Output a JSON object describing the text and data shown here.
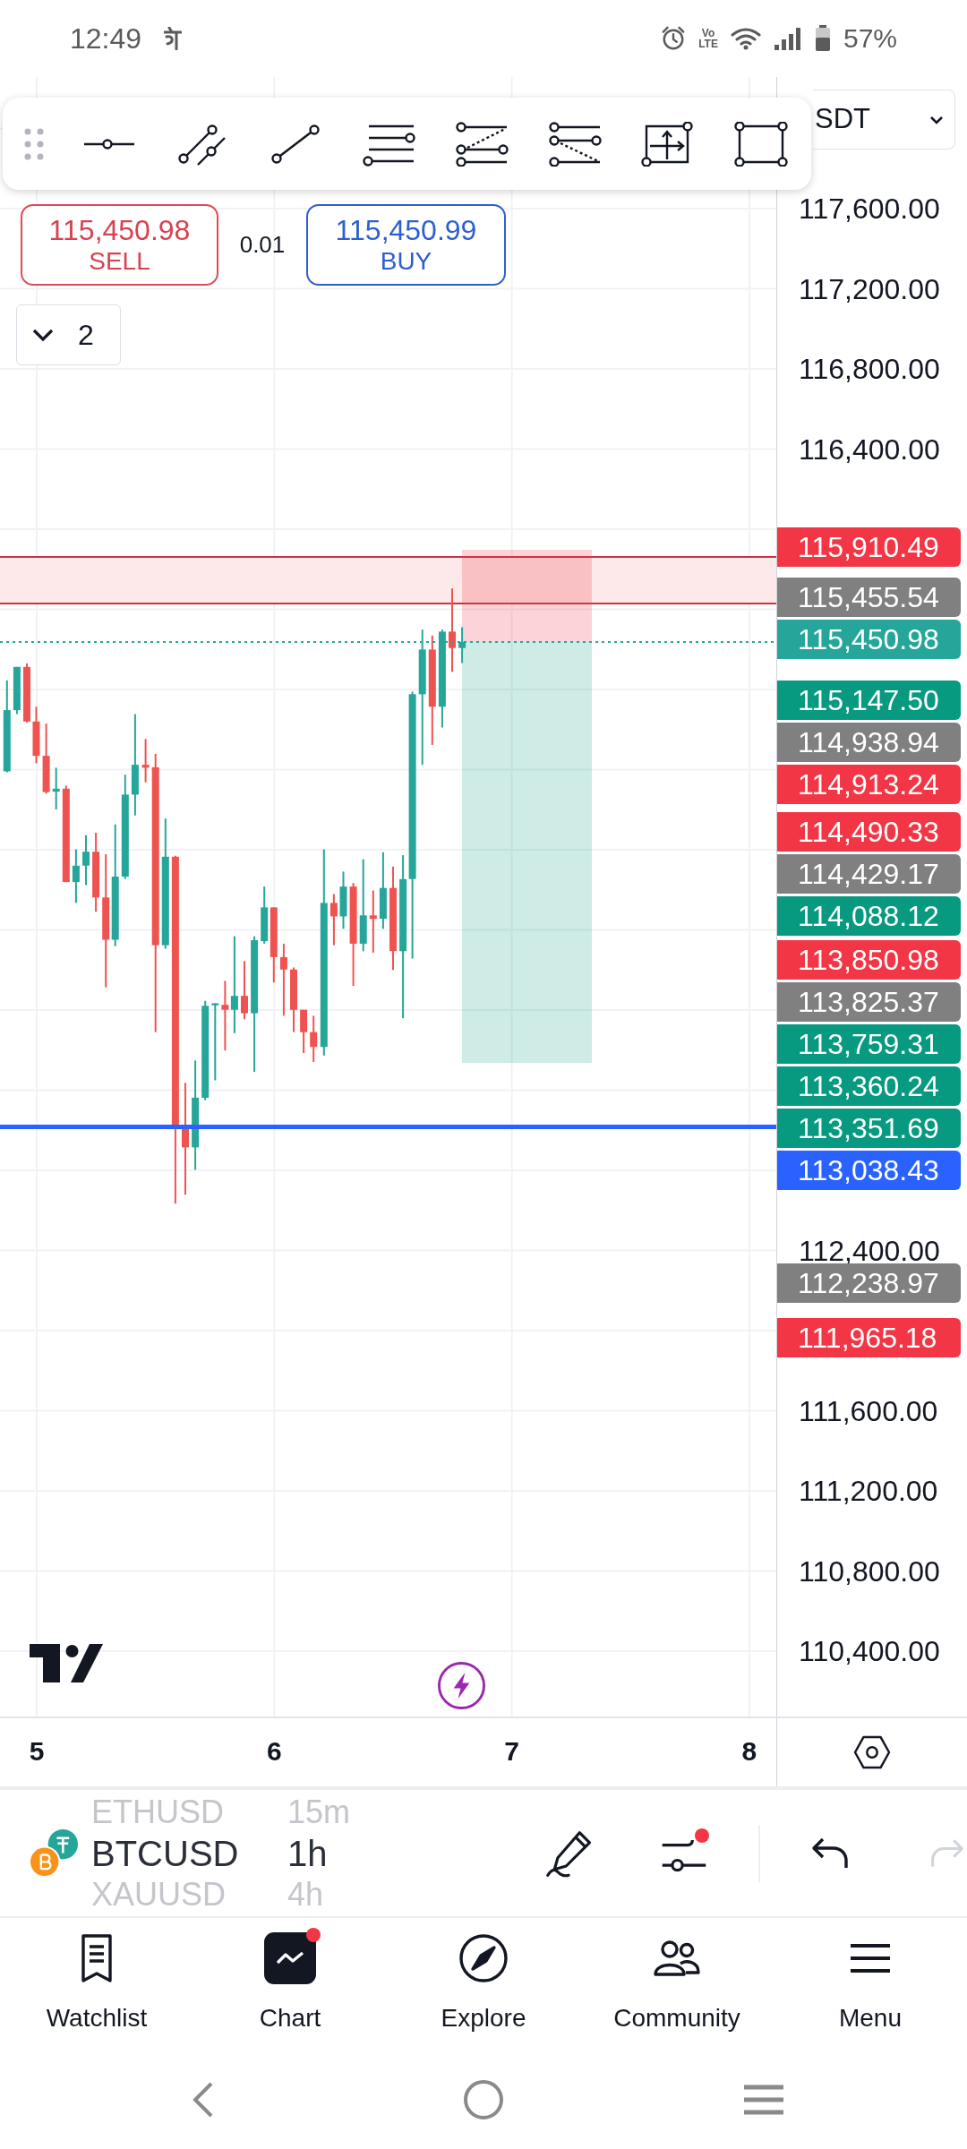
{
  "status_bar": {
    "time": "12:49",
    "voice_label": "Vo",
    "network_label": "LTE",
    "battery": "57%"
  },
  "symbol_selector": {
    "text": "SDT"
  },
  "order_panel": {
    "sell": {
      "price": "115,450.98",
      "label": "SELL"
    },
    "spread": "0.01",
    "buy": {
      "price": "115,450.99",
      "label": "BUY"
    }
  },
  "indicators_toggle": {
    "count": "2"
  },
  "price_axis": {
    "labels": [
      "117,600.00",
      "117,200.00",
      "116,800.00",
      "116,400.00",
      "112,400.00",
      "111,600.00",
      "111,200.00",
      "110,800.00",
      "110,400.00"
    ],
    "tags": [
      {
        "text": "115,910.49",
        "color": "#f23645",
        "kind": "line"
      },
      {
        "text": "115,455.54",
        "color": "#808080",
        "kind": "line"
      },
      {
        "text": "115,450.98",
        "color": "#26a69a",
        "kind": "last-price"
      },
      {
        "text": "115,147.50",
        "color": "#089981",
        "kind": "line"
      },
      {
        "text": "114,938.94",
        "color": "#808080",
        "kind": "line"
      },
      {
        "text": "114,913.24",
        "color": "#f23645",
        "kind": "line"
      },
      {
        "text": "114,490.33",
        "color": "#f23645",
        "kind": "line"
      },
      {
        "text": "114,429.17",
        "color": "#808080",
        "kind": "line"
      },
      {
        "text": "114,088.12",
        "color": "#089981",
        "kind": "line"
      },
      {
        "text": "113,850.98",
        "color": "#f23645",
        "kind": "line"
      },
      {
        "text": "113,825.37",
        "color": "#808080",
        "kind": "line"
      },
      {
        "text": "113,759.31",
        "color": "#089981",
        "kind": "line"
      },
      {
        "text": "113,360.24",
        "color": "#089981",
        "kind": "line"
      },
      {
        "text": "113,351.69",
        "color": "#089981",
        "kind": "line"
      },
      {
        "text": "113,038.43",
        "color": "#2962ff",
        "kind": "line"
      },
      {
        "text": "112,238.97",
        "color": "#808080",
        "kind": "line"
      },
      {
        "text": "111,965.18",
        "color": "#f23645",
        "kind": "line"
      }
    ]
  },
  "time_axis": {
    "labels": [
      "5",
      "6",
      "7",
      "8"
    ]
  },
  "symbol_picker": {
    "items": [
      {
        "symbol": "ETHUSD",
        "interval": "15m",
        "selected": false
      },
      {
        "symbol": "BTCUSD",
        "interval": "1h",
        "selected": true
      },
      {
        "symbol": "XAUUSD",
        "interval": "4h",
        "selected": false
      }
    ]
  },
  "chart_actions": [
    {
      "kind": "draw",
      "notification": false,
      "disabled": false
    },
    {
      "kind": "indicators",
      "notification": true,
      "disabled": false
    },
    {
      "kind": "undo",
      "notification": false,
      "disabled": false
    },
    {
      "kind": "redo",
      "notification": false,
      "disabled": true
    }
  ],
  "bottom_nav": {
    "items": [
      {
        "kind": "watchlist",
        "label": "Watchlist",
        "selected": false,
        "notification": false
      },
      {
        "kind": "chart",
        "label": "Chart",
        "selected": true,
        "notification": true
      },
      {
        "kind": "explore",
        "label": "Explore",
        "selected": false,
        "notification": false
      },
      {
        "kind": "community",
        "label": "Community",
        "selected": false,
        "notification": false
      },
      {
        "kind": "menu",
        "label": "Menu",
        "selected": false,
        "notification": false
      }
    ]
  }
}
